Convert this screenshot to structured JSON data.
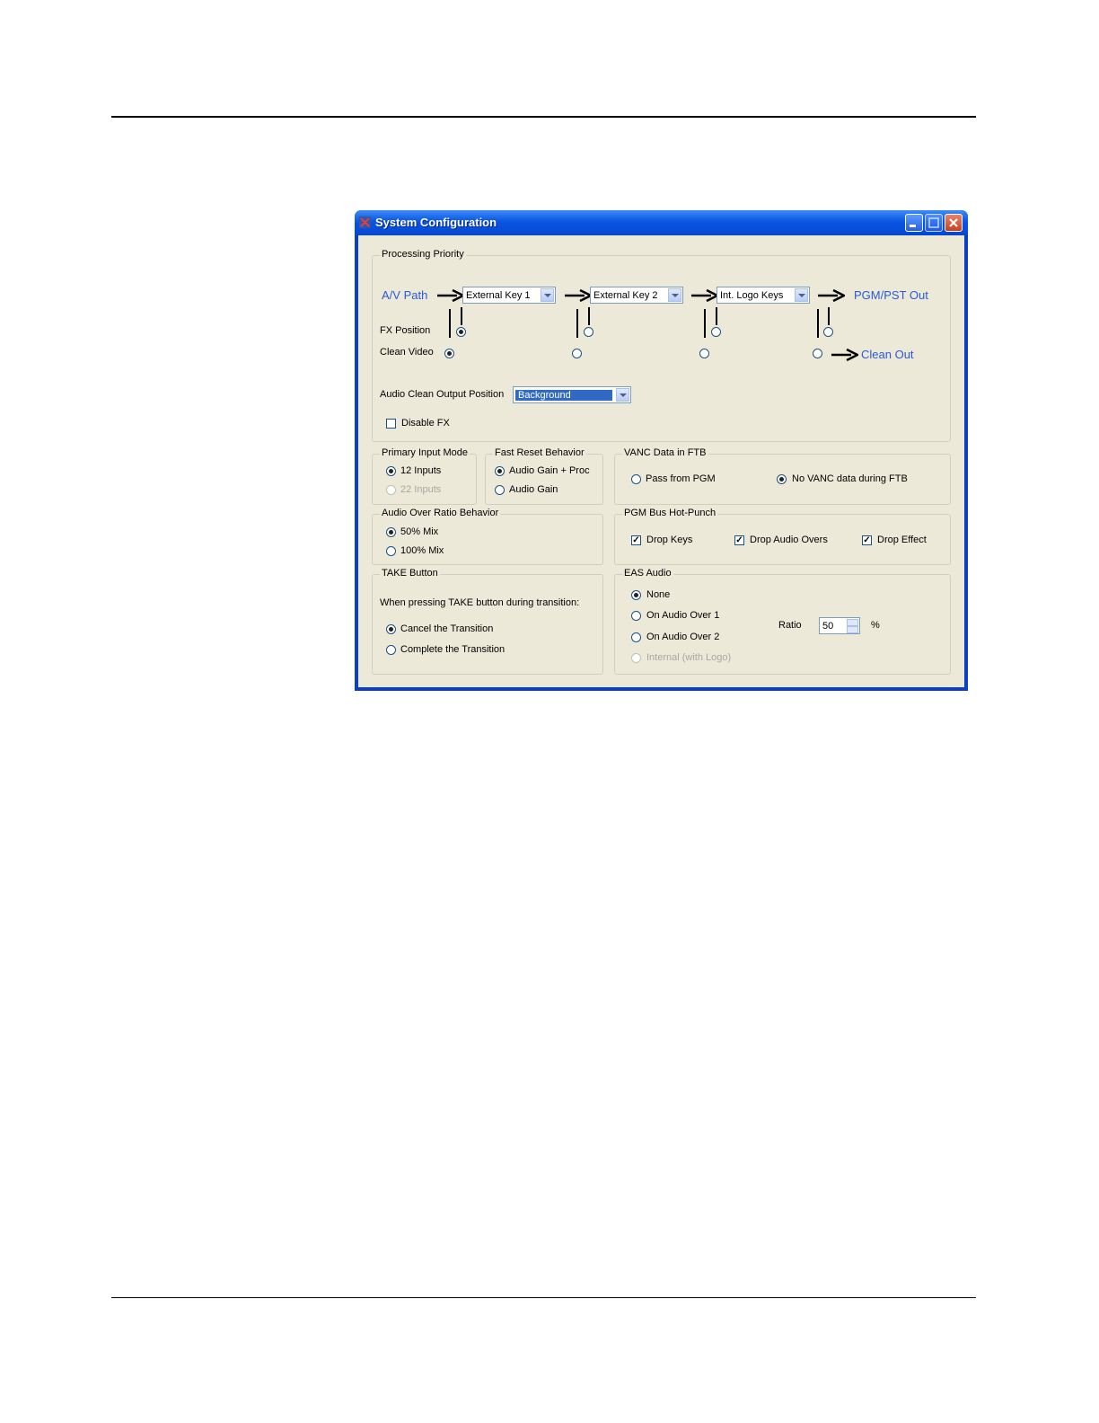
{
  "window": {
    "title": "System Configuration"
  },
  "processing_priority": {
    "legend": "Processing Priority",
    "av_path_label": "A/V Path",
    "key1": "External Key 1",
    "key2": "External Key 2",
    "key3": "Int. Logo Keys",
    "pgm_out_label": "PGM/PST Out",
    "fx_position_label": "FX Position",
    "clean_video_label": "Clean Video",
    "clean_out_label": "Clean Out",
    "audio_clean_label": "Audio Clean Output Position",
    "audio_clean_value": "Background",
    "disable_fx_label": "Disable FX"
  },
  "primary_input_mode": {
    "legend": "Primary Input Mode",
    "opt1": "12 Inputs",
    "opt2": "22 Inputs"
  },
  "fast_reset": {
    "legend": "Fast Reset Behavior",
    "opt1": "Audio Gain + Proc",
    "opt2": "Audio Gain"
  },
  "vanc": {
    "legend": "VANC Data in FTB",
    "opt1": "Pass from PGM",
    "opt2": "No VANC data during FTB"
  },
  "audio_over": {
    "legend": "Audio Over Ratio Behavior",
    "opt1": "50% Mix",
    "opt2": "100% Mix"
  },
  "pgm_hot_punch": {
    "legend": "PGM Bus Hot-Punch",
    "opt1": "Drop Keys",
    "opt2": "Drop Audio Overs",
    "opt3": "Drop Effect"
  },
  "take_button": {
    "legend": "TAKE Button",
    "desc": "When pressing TAKE button during transition:",
    "opt1": "Cancel the Transition",
    "opt2": "Complete the Transition"
  },
  "eas_audio": {
    "legend": "EAS Audio",
    "opt1": "None",
    "opt2": "On Audio Over 1",
    "opt3": "On Audio Over 2",
    "opt4": "Internal (with Logo)",
    "ratio_label": "Ratio",
    "ratio_value": "50",
    "ratio_unit": "%"
  }
}
